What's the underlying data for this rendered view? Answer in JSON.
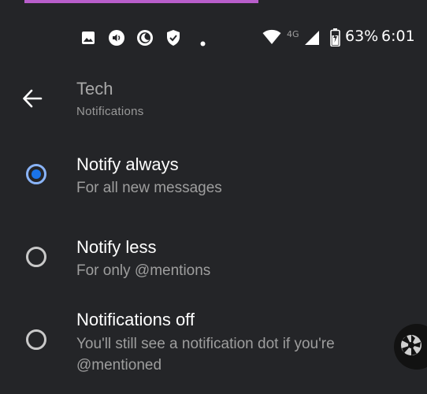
{
  "status_bar": {
    "icons": [
      "image-icon",
      "volume-icon",
      "moon-icon",
      "shield-icon",
      "dot-icon",
      "wifi-icon",
      "signal-icon",
      "battery-icon"
    ],
    "network": "4G",
    "battery": "63%",
    "time": "6:01"
  },
  "header": {
    "back_icon": "arrow-back-icon",
    "title": "Tech",
    "subtitle": "Notifications"
  },
  "options": [
    {
      "label": "Notify always",
      "description": "For all new messages",
      "selected": true
    },
    {
      "label": "Notify less",
      "description": "For only @mentions",
      "selected": false
    },
    {
      "label": "Notifications off",
      "description": "You'll still see a notification dot if you're @mentioned",
      "selected": false
    }
  ],
  "floating_button": {
    "icon": "camera-shutter-icon"
  },
  "colors": {
    "background": "#242528",
    "accent_bar": "#b85ecb",
    "radio_selected": "#1a73e8",
    "text_primary": "#ffffff",
    "text_secondary": "#9e9e9e"
  }
}
